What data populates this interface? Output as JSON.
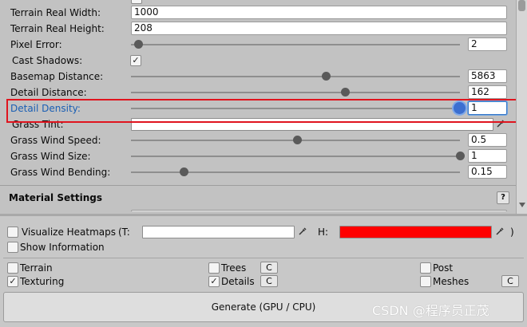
{
  "terrain": {
    "real_width": {
      "label": "Terrain Real Width:",
      "value": "1000"
    },
    "real_height": {
      "label": "Terrain Real Height:",
      "value": "208"
    },
    "pixel_error": {
      "label": "Pixel Error:",
      "value": "2"
    },
    "cast_shadows": {
      "label": "Cast Shadows:",
      "checked_glyph": "✓"
    },
    "basemap_distance": {
      "label": "Basemap Distance:",
      "value": "5863"
    },
    "detail_distance": {
      "label": "Detail Distance:",
      "value": "162"
    },
    "detail_density": {
      "label": "Detail Density:",
      "value": "1"
    },
    "grass_tint": {
      "label": "Grass Tint:",
      "color": "#ffffff"
    },
    "grass_wind_speed": {
      "label": "Grass Wind Speed:",
      "value": "0.5"
    },
    "grass_wind_size": {
      "label": "Grass Wind Size:",
      "value": "1"
    },
    "grass_wind_bending": {
      "label": "Grass Wind Bending:",
      "value": "0.15"
    }
  },
  "material_settings": {
    "title": "Material Settings",
    "help": "?"
  },
  "heatmaps": {
    "visualize_label": "Visualize Heatmaps",
    "t_label": "(T:",
    "t_color": "#ffffff",
    "h_label": "H:",
    "h_color": "#ff0000",
    "close_paren": ")",
    "show_info_label": "Show Information"
  },
  "generate_options": {
    "terrain": "Terrain",
    "texturing": "Texturing",
    "trees": "Trees",
    "details": "Details",
    "post": "Post",
    "meshes": "Meshes",
    "c_label": "C",
    "check_glyph": "✓"
  },
  "generate_button": "Generate (GPU / CPU)",
  "watermark": "CSDN @程序员正茂",
  "icons": {
    "picker": "eyedropper-icon"
  },
  "colors": {
    "highlight_box": "#e0141e",
    "focus_blue": "#3a78c8",
    "label_blue": "#1a5fb4"
  }
}
